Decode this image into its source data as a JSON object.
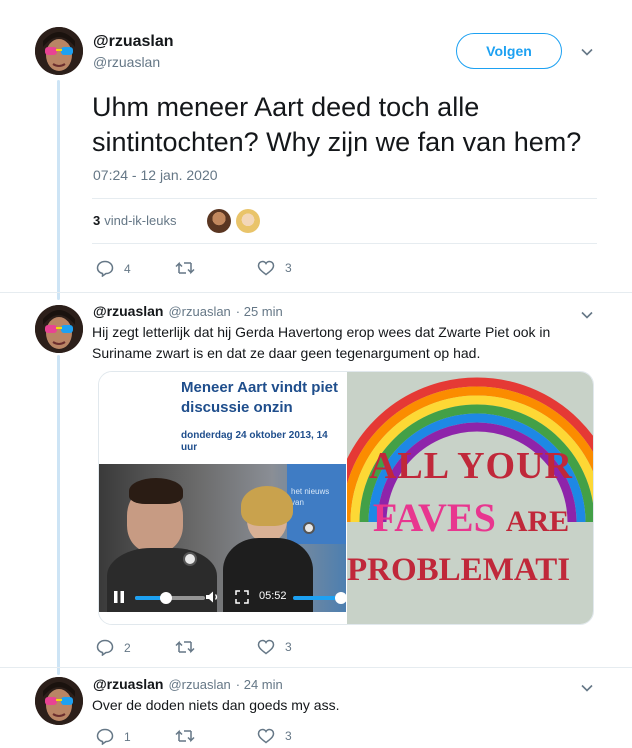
{
  "main_tweet": {
    "display_name": "@rzuaslan",
    "handle": "@rzuaslan",
    "follow_label": "Volgen",
    "text": "Uhm meneer Aart deed toch alle sintintochten? Why zijn we fan van hem?",
    "timestamp": "07:24 - 12 jan. 2020",
    "likes_count": "3",
    "likes_label": "vind-ik-leuks",
    "actions": {
      "reply_count": "4",
      "retweet_count": "",
      "like_count": "3"
    }
  },
  "reply_1": {
    "display_name": "@rzuaslan",
    "handle": "@rzuaslan",
    "time": "· 25 min",
    "text": "Hij zegt letterlijk dat hij Gerda Havertong erop wees dat Zwarte Piet ook in Suriname zwart is en dat ze daar geen tegenargument op had.",
    "article": {
      "headline_line1": "Meneer Aart vindt piet",
      "headline_line2": "discussie onzin",
      "date_line1": "donderdag 24 oktober 2013, 14",
      "date_line2": "uur",
      "video_time": "05:52",
      "video_bg_text": "het nieuws van"
    },
    "meme": {
      "line1": "ALL YOUR",
      "line2_a": "FAVES",
      "line2_b": "ARE",
      "line3": "PROBLEMATI"
    },
    "actions": {
      "reply_count": "2",
      "retweet_count": "",
      "like_count": "3"
    }
  },
  "reply_2": {
    "display_name": "@rzuaslan",
    "handle": "@rzuaslan",
    "time": "· 24 min",
    "text": "Over de doden niets dan goeds my ass.",
    "actions": {
      "reply_count": "1",
      "retweet_count": "",
      "like_count": "3"
    }
  },
  "colors": {
    "accent": "#1da1f2",
    "text": "#14171a",
    "muted": "#657786",
    "thread_line": "#cde4f5",
    "meme_red": "#c0283a",
    "meme_pink": "#e8368f",
    "headline_blue": "#1f4e8c"
  },
  "icons": [
    "chevron-down-icon",
    "reply-icon",
    "retweet-icon",
    "like-icon",
    "pause-icon",
    "volume-icon",
    "fullscreen-icon"
  ]
}
